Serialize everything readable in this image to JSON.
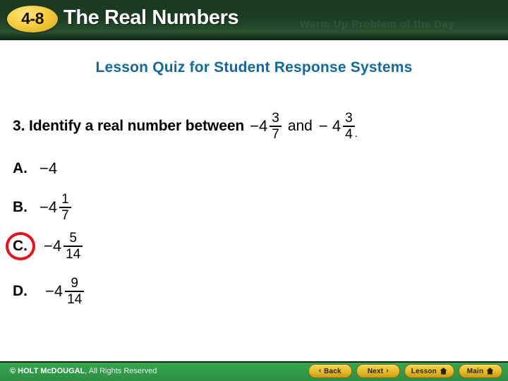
{
  "header": {
    "badge": "4-8",
    "title": "The Real Numbers",
    "watermark": "Warm Up Problem of the Day",
    "bg_color": "#1b3d22",
    "badge_color": "#f6ce3f"
  },
  "subtitle": {
    "text": "Lesson Quiz for Student Response Systems",
    "color": "#12699f"
  },
  "question": {
    "number_and_prompt": "3. Identify a real number between",
    "operand_a": {
      "sign": "−4",
      "numerator": "3",
      "denominator": "7"
    },
    "conjunction": "and",
    "operand_b": {
      "sign": "− 4",
      "numerator": "3",
      "denominator": "4"
    },
    "trailing": "."
  },
  "choices": [
    {
      "letter": "A.",
      "plain": "−4",
      "has_fraction": false,
      "whole": "",
      "numerator": "",
      "denominator": "",
      "selected": false
    },
    {
      "letter": "B.",
      "plain": "",
      "has_fraction": true,
      "whole": "−4",
      "numerator": "1",
      "denominator": "7",
      "selected": false
    },
    {
      "letter": "C.",
      "plain": "",
      "has_fraction": true,
      "whole": "−4",
      "numerator": "5",
      "denominator": "14",
      "selected": true
    },
    {
      "letter": "D.",
      "plain": "",
      "has_fraction": true,
      "whole": "−4",
      "numerator": "9",
      "denominator": "14",
      "selected": false
    }
  ],
  "highlight": {
    "color": "#e8111b",
    "target_letter": "C."
  },
  "footer": {
    "copyright_strong": "© HOLT McDOUGAL",
    "copyright_light": ", All Rights Reserved",
    "bg_color": "#31984a",
    "buttons": [
      {
        "label": "Back",
        "icon": "chevron-left-icon",
        "glyph": "‹"
      },
      {
        "label": "Next",
        "icon": "chevron-right-icon",
        "glyph": "›"
      },
      {
        "label": "Lesson",
        "icon": "home-icon",
        "glyph": ""
      },
      {
        "label": "Main",
        "icon": "home-icon",
        "glyph": ""
      }
    ]
  }
}
